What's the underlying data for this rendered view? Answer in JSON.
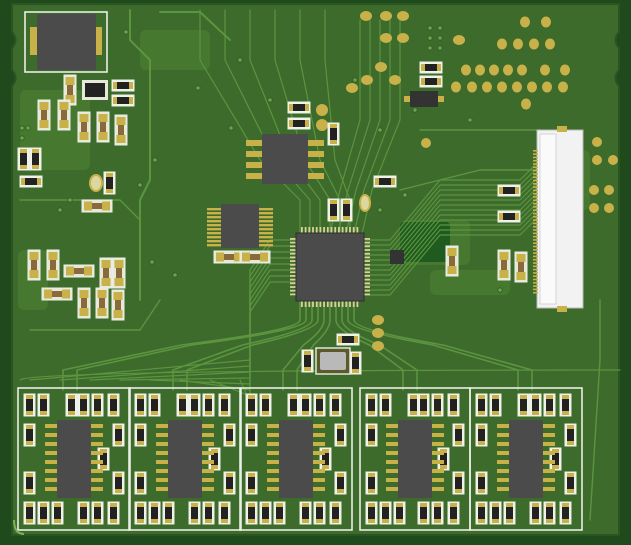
{
  "board": {
    "type": "pcb-render",
    "colors": {
      "substrate": "#1f4a1c",
      "soldermask": "#3c6b2b",
      "copper_pour": "#4a7d33",
      "trace": "#5c9440",
      "pad": "#c9b14a",
      "silkscreen": "#e9efe4",
      "ic_body": "#4b4b4b",
      "connector_body": "#f2f2f2"
    },
    "component_counts": {
      "qfp_mcu": 1,
      "soic_ics": 7,
      "ffc_connector": 1,
      "crystal": 1,
      "inductor": 1,
      "output_channels": 5
    }
  }
}
